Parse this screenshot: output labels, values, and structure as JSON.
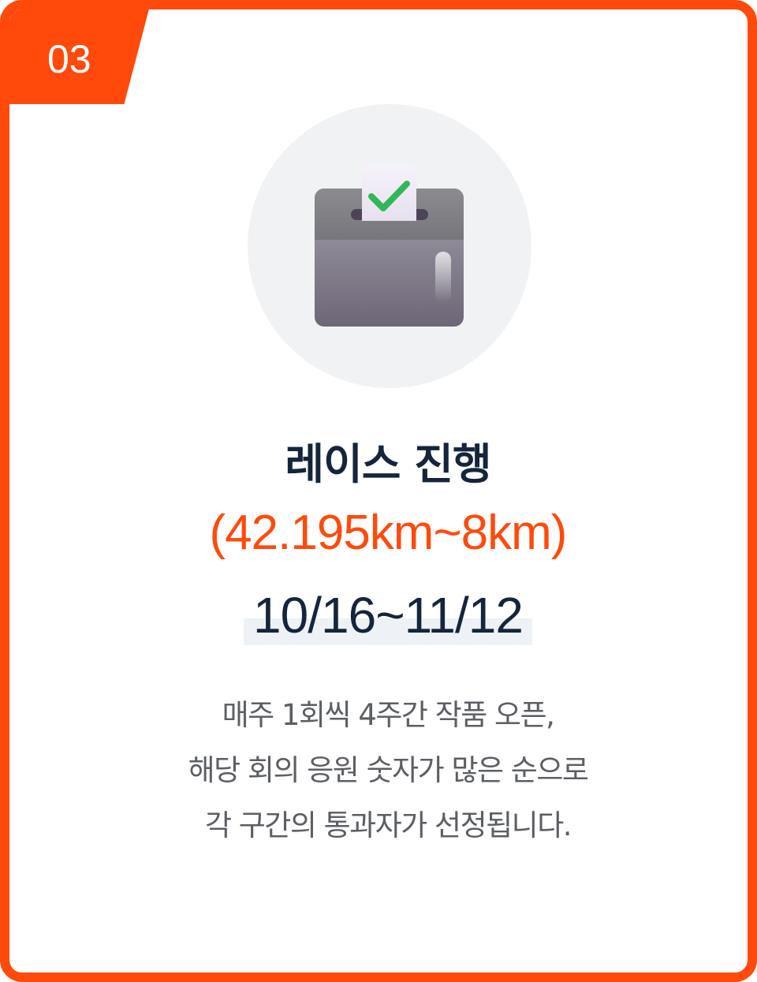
{
  "step": {
    "number": "03"
  },
  "icon": {
    "name": "ballot-box-icon"
  },
  "title": "레이스 진행",
  "distance": "(42.195km~8km)",
  "period": "10/16~11/12",
  "description": [
    "매주 1회씩 4주간 작품 오픈,",
    "해당 회의 응원 숫자가 많은 순으로",
    "각 구간의 통과자가 선정됩니다."
  ],
  "colors": {
    "accent": "#ff4a0c",
    "title": "#14253d",
    "body_text": "#5b5e63",
    "icon_background": "#f1f2f4",
    "check": "#2fb85a"
  }
}
